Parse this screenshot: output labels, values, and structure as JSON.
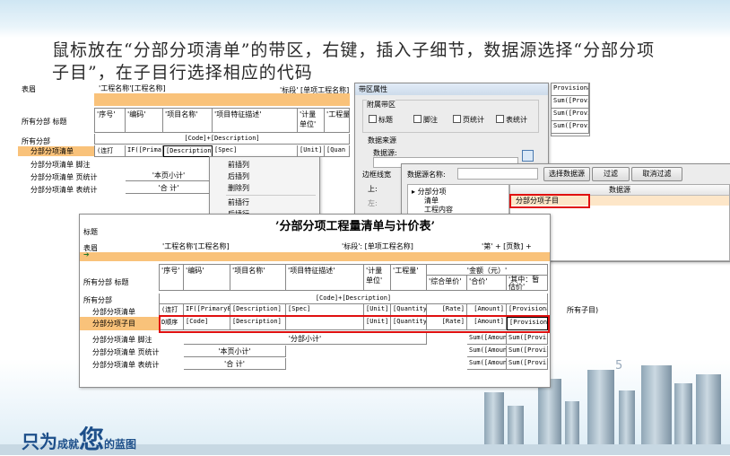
{
  "slide": {
    "instruction_line1": "鼠标放在“分部分项清单”的带区，右键，插入子细节，数据源选择“分部分项",
    "instruction_line2": "子目”，在子目行选择相应的代码",
    "brand_a": "只为",
    "brand_b": "成就",
    "brand_c": "您",
    "brand_d": "的蓝图",
    "page_number": "5"
  },
  "back_designer": {
    "header_label": "表眉",
    "title_field": "'工程名称'",
    "title_value": "[工程名称]",
    "section_label_field": "'标段'",
    "section_value": "[单项工程名称]",
    "col_headers": [
      "'序号'",
      "'编码'",
      "'项目名称'",
      "'项目特征描述'",
      "'计量单位'",
      "'工程量'"
    ],
    "bands": [
      "所有分部 标题",
      "所有分部",
      "分部分项清单",
      "分部分项清单 脚注",
      "分部分项清单 页统计",
      "分部分项清单 表统计"
    ],
    "code_desc": "[Code]+[Description]",
    "row_seq": "(连打",
    "row_code": "IF([Primary8",
    "row_desc": "[Description]",
    "row_spec": "[Spec]",
    "row_unit": "[Unit]",
    "row_qty": "[Quan",
    "page_total": "'本页小计'",
    "grand_total": "'合    计'"
  },
  "context_menu": {
    "items": [
      "前插列",
      "后插列",
      "删除列",
      "前插行",
      "后插行"
    ]
  },
  "band_props": {
    "title": "带区属性",
    "section_attached": "附属带区",
    "checks": [
      "标题",
      "脚注",
      "页统计",
      "表统计"
    ],
    "datasource_label": "数据来源",
    "datasource_field": "数据源:",
    "border_label": "边框线宽",
    "left_label": "左:",
    "top_label": "上:"
  },
  "ds_dialog": {
    "name_label": "数据源名称:",
    "btn_select": "选择数据源",
    "btn_filter": "过滤",
    "btn_cancel_filter": "取消过滤",
    "col_header": "数据源",
    "tree_root": "分部分项",
    "tree_child1": "清单",
    "tree_child2": "工程内容",
    "selected_item": "分部分项子目",
    "partial_item": "较)",
    "row_label": "所有子目)"
  },
  "right_back": {
    "rows": [
      "Provisiona",
      "Sum([Provis",
      "Sum([Provis",
      "Sum([Provis"
    ]
  },
  "front_designer": {
    "report_title": "’分部分项工程量清单与计价表’",
    "band_title_label": "标题",
    "band_header_label": "表眉",
    "project_field": "'工程名称'",
    "project_value": "[工程名称]",
    "section_field": "'标段'",
    "section_value": "[单项工程名称]",
    "page_expr": "'第' + [页数] +",
    "col_seq": "'序号'",
    "col_code": "'编码'",
    "col_name": "'项目名称'",
    "col_spec": "'项目特征描述'",
    "col_unit": "'计量单位'",
    "col_qty": "'工程量'",
    "col_amount_group": "'金额（元）'",
    "col_unit_price": "'综合单价'",
    "col_total": "'合价'",
    "col_provisional": "'其中：暂估价'",
    "bands": [
      "所有分部 标题",
      "所有分部",
      "分部分项清单",
      "分部分项子目",
      "分部分项清单 脚注",
      "分部分项清单 页统计",
      "分部分项清单 表统计"
    ],
    "code_desc": "[Code]+[Description]",
    "list_row": [
      "(连打",
      "IF([Primary8",
      "[Description]",
      "[Spec]",
      "[Unit]",
      "[Quantity]",
      "[Rate]",
      "[Amount]",
      "[Provisiona"
    ],
    "sub_row": [
      "D顺序",
      "[Code]",
      "[Description]",
      "",
      "[Unit]",
      "[Quantity]",
      "[Rate]",
      "[Amount]",
      "[Provisiona"
    ],
    "footer_text": "'分部小计'",
    "page_total": "'本页小计'",
    "grand_total": "'合    计'",
    "sum_amount": "Sum([Amoun",
    "sum_prov": "Sum([Provis"
  },
  "colors": {
    "highlight_row": "#f9c27a",
    "red_box": "#e01010",
    "brand_blue": "#1d4f8a"
  }
}
